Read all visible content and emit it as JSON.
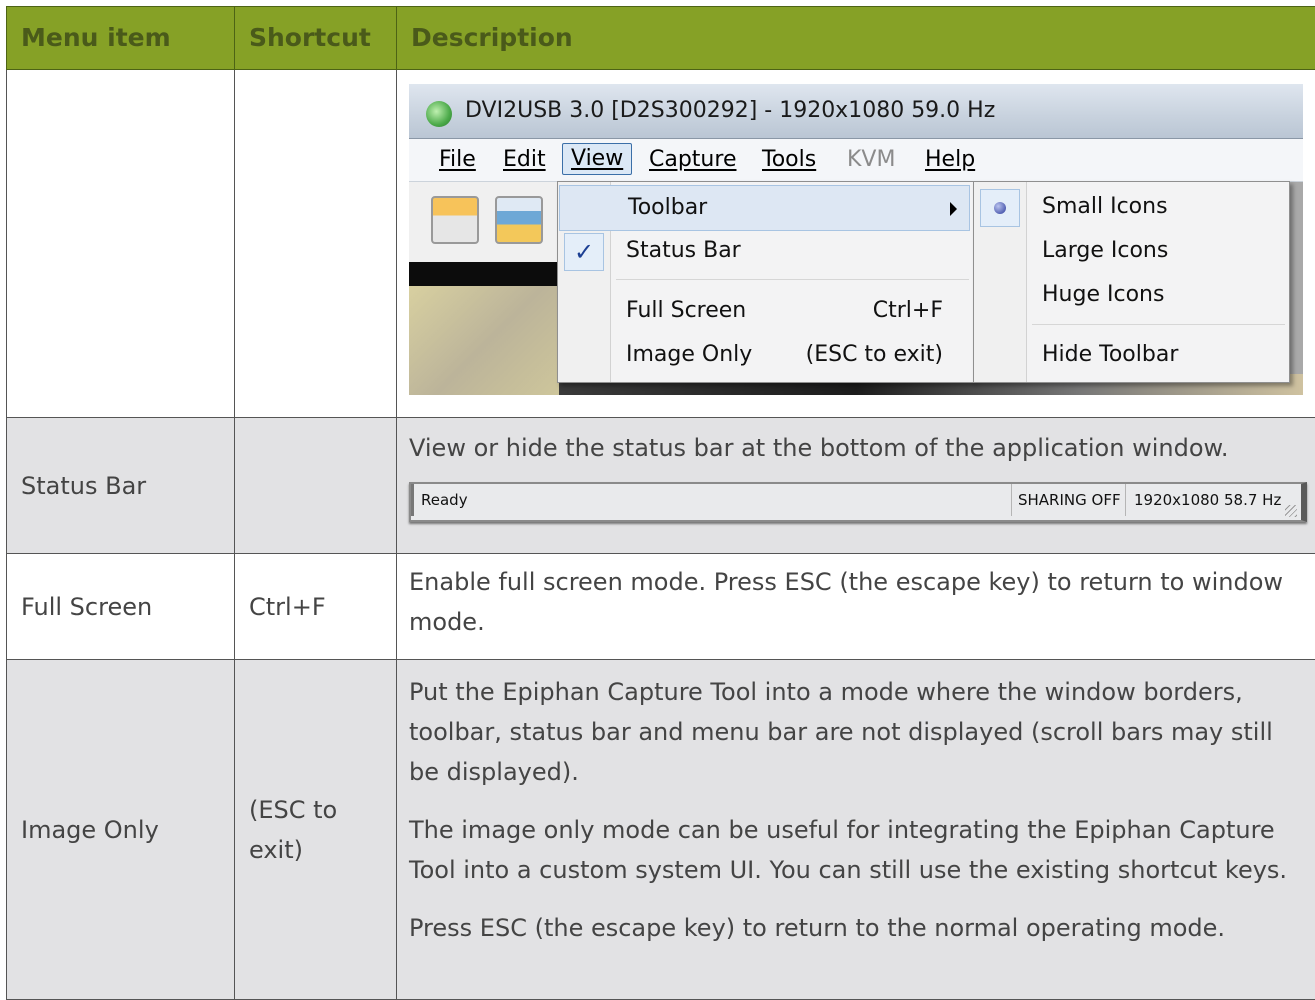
{
  "table": {
    "headers": {
      "menu_item": "Menu item",
      "shortcut": "Shortcut",
      "description": "Description"
    },
    "rows": [
      {
        "menu_item": "",
        "shortcut": "",
        "has_screenshot": true
      },
      {
        "menu_item": "Status Bar",
        "shortcut": "",
        "description": [
          "View or hide the status bar at the bottom of the application window."
        ]
      },
      {
        "menu_item": "Full Screen",
        "shortcut": "Ctrl+F",
        "description": [
          "Enable full screen mode. Press ESC (the escape key) to return to window mode."
        ]
      },
      {
        "menu_item": "Image Only",
        "shortcut": "(ESC to exit)",
        "description": [
          "Put the Epiphan Capture Tool into a mode where the window borders, toolbar, status bar and menu bar are not displayed (scroll bars may still be displayed).",
          "The image only mode can be useful for integrating the Epiphan Capture Tool into a custom system UI. You can still use the existing shortcut keys.",
          "Press ESC (the escape key) to return to the normal operating mode."
        ]
      }
    ]
  },
  "screenshot": {
    "window_title": "DVI2USB 3.0 [D2S300292]  - 1920x1080 59.0 Hz",
    "menu": [
      "File",
      "Edit",
      "View",
      "Capture",
      "Tools",
      "KVM",
      "Help"
    ],
    "active_menu": "View",
    "disabled_menu": "KVM",
    "view_menu": [
      {
        "label": "Toolbar",
        "shortcut": ""
      },
      {
        "label": "Status Bar",
        "shortcut": ""
      },
      {
        "label": "Full Screen",
        "shortcut": "Ctrl+F"
      },
      {
        "label": "Image Only",
        "shortcut": "(ESC to exit)"
      }
    ],
    "check_mark": "✓",
    "toolbar_submenu": [
      "Small Icons",
      "Large Icons",
      "Huge Icons",
      "Hide Toolbar"
    ]
  },
  "status_bar": {
    "ready": "Ready",
    "sharing": "SHARING OFF",
    "resolution": "1920x1080 58.7 Hz"
  },
  "colors": {
    "header_bg": "#86a126",
    "header_text": "#4a5a1a",
    "alt_row_bg": "#e2e2e4",
    "body_text": "#444444"
  },
  "icons": [
    "app-logo-icon",
    "save-icon",
    "print-icon",
    "submenu-arrow-icon",
    "check-icon",
    "radio-dot-icon",
    "resize-grip-icon"
  ]
}
